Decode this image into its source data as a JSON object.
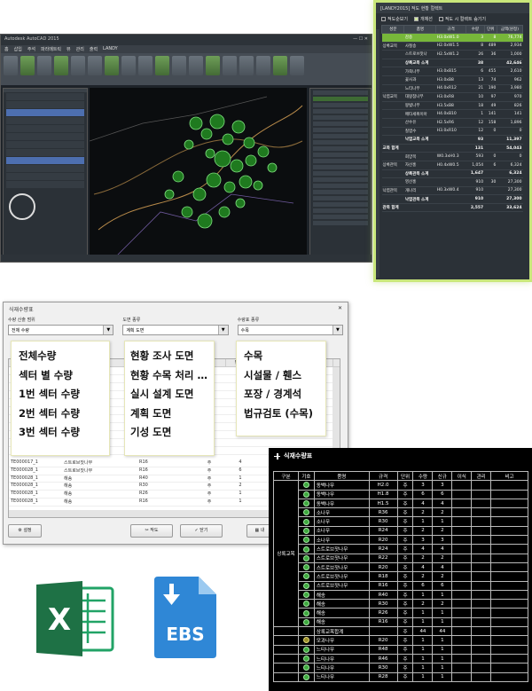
{
  "zoom_panel": {
    "title": "[LANDY2015] 적도 현황 컬렉트",
    "checkboxes": [
      {
        "label": "적도순보기",
        "checked": false
      },
      {
        "label": "개체선",
        "checked": true
      },
      {
        "label": "적도 시 컬렉트 숨기기",
        "checked": false
      }
    ],
    "columns": [
      "성분",
      "품명",
      "규격",
      "수량",
      "단위",
      "금액(원정)"
    ],
    "rows": [
      [
        "",
        "감송",
        "H3.0xW1.0",
        "3",
        "8",
        "76,774"
      ],
      [
        "상록교목",
        "사철송",
        "H2.0xW1.5",
        "8",
        "489",
        "2,934"
      ],
      [
        "",
        "스트로브잣나",
        "H2.5xW1.2",
        "26",
        "36",
        "1,000"
      ],
      [
        "",
        "상록교목 소계",
        "",
        "38",
        "",
        "42,646"
      ],
      [
        "",
        "가죽나무",
        "H3.0xB15",
        "6",
        "455",
        "2,610"
      ],
      [
        "",
        "꽃사과",
        "H3.0xB8",
        "13",
        "74",
        "962"
      ],
      [
        "",
        "느티나무",
        "H4.0xR12",
        "21",
        "190",
        "3,980"
      ],
      [
        "낙엽교목",
        "대왕참나무",
        "H3.0xR8",
        "10",
        "97",
        "970"
      ],
      [
        "",
        "왕벚나무",
        "H3.5xB8",
        "18",
        "49",
        "826"
      ],
      [
        "",
        "메타세쿼이아",
        "H4.0xB10",
        "1",
        "141",
        "141"
      ],
      [
        "",
        "산수유",
        "H2.5xR6",
        "12",
        "158",
        "1,896"
      ],
      [
        "",
        "칠엽수",
        "H3.0xR10",
        "12",
        "0",
        "0"
      ],
      [
        "",
        "낙엽교목 소계",
        "",
        "93",
        "",
        "11,397"
      ],
      [
        "교목 합계",
        "",
        "",
        "131",
        "",
        "54,043"
      ],
      [
        "",
        "회양목",
        "W0.3xH0.3",
        "593",
        "0",
        "0"
      ],
      [
        "상록관목",
        "자산홍",
        "H0.4xW0.5",
        "1,054",
        "6",
        "6,324"
      ],
      [
        "",
        "상록관목 소계",
        "",
        "1,647",
        "",
        "6,324"
      ],
      [
        "",
        "영산홍",
        "",
        "910",
        "30",
        "27,300"
      ],
      [
        "낙엽관목",
        "개나리",
        "H0.3xW0.4",
        "910",
        "",
        "27,300"
      ],
      [
        "",
        "낙엽관목 소계",
        "",
        "910",
        "",
        "27,300"
      ],
      [
        "관목 합계",
        "",
        "",
        "2,557",
        "",
        "33,624"
      ]
    ]
  },
  "dialog": {
    "title": "식재수량표",
    "group1_label": "수량 산출 범위",
    "group1_value": "전체 수량",
    "group2_label": "도면 종류",
    "group2_value": "계획 도면",
    "group3_label": "수량표 종류",
    "group3_value": "수목",
    "grid_header": [
      "",
      "품명",
      "",
      "",
      "단위",
      ""
    ],
    "grid_rows": [
      [
        "TE000017_1",
        "스트로브잣나무",
        "R16",
        "주",
        "4"
      ],
      [
        "TE000028_1",
        "스트로브잣나무",
        "R16",
        "주",
        "6"
      ],
      [
        "TE000028_1",
        "해송",
        "R40",
        "주",
        "1"
      ],
      [
        "TE000028_1",
        "해송",
        "R30",
        "주",
        "2"
      ],
      [
        "TE000028_1",
        "해송",
        "R26",
        "주",
        "1"
      ],
      [
        "TE000028_1",
        "해송",
        "R16",
        "주",
        "1"
      ]
    ],
    "btn_settings": "설정",
    "btn_export": "작도",
    "btn_close": "닫기",
    "btn_extra": "내"
  },
  "options": {
    "range": [
      "전체수량",
      "섹터 별 수량",
      "1번 섹터 수량",
      "2번 섹터 수량",
      "3번 섹터 수량"
    ],
    "drawing": [
      "현황 조사 도면",
      "현황 수목 처리 …",
      "실시 설계 도면",
      "계획 도면",
      "기성 도면"
    ],
    "table": [
      "수목",
      "시설물 / 휀스",
      "포장 / 경계석",
      "법규검토 (수목)"
    ]
  },
  "icons": {
    "excel": {
      "letter": "X",
      "color": "#1e7145"
    },
    "ebs": {
      "label": "EBS",
      "color": "#2f87d6"
    }
  },
  "cad_table": {
    "title": "식재수량표",
    "columns": [
      "구분",
      "기호",
      "품명",
      "규격",
      "단위",
      "수량",
      "신규",
      "이식",
      "관리",
      "비고"
    ],
    "group_label": "상록교목",
    "rows": [
      [
        "",
        "g",
        "동백나무",
        "H2.0",
        "주",
        "3",
        "3",
        "",
        "",
        ""
      ],
      [
        "",
        "g",
        "동백나무",
        "H1.8",
        "주",
        "6",
        "6",
        "",
        "",
        ""
      ],
      [
        "",
        "g",
        "동백나무",
        "H1.5",
        "주",
        "4",
        "4",
        "",
        "",
        ""
      ],
      [
        "",
        "g",
        "소나무",
        "R36",
        "주",
        "2",
        "2",
        "",
        "",
        ""
      ],
      [
        "",
        "g",
        "소나무",
        "R30",
        "주",
        "1",
        "1",
        "",
        "",
        ""
      ],
      [
        "",
        "g",
        "소나무",
        "R24",
        "주",
        "2",
        "2",
        "",
        "",
        ""
      ],
      [
        "",
        "g",
        "소나무",
        "R20",
        "주",
        "3",
        "3",
        "",
        "",
        ""
      ],
      [
        "",
        "g",
        "스트로브잣나무",
        "R24",
        "주",
        "4",
        "4",
        "",
        "",
        ""
      ],
      [
        "",
        "g",
        "스트로브잣나무",
        "R22",
        "주",
        "2",
        "2",
        "",
        "",
        ""
      ],
      [
        "",
        "g",
        "스트로브잣나무",
        "R20",
        "주",
        "4",
        "4",
        "",
        "",
        ""
      ],
      [
        "",
        "g",
        "스트로브잣나무",
        "R18",
        "주",
        "2",
        "2",
        "",
        "",
        ""
      ],
      [
        "",
        "g",
        "스트로브잣나무",
        "R16",
        "주",
        "6",
        "6",
        "",
        "",
        ""
      ],
      [
        "",
        "g",
        "해송",
        "R40",
        "주",
        "1",
        "1",
        "",
        "",
        ""
      ],
      [
        "",
        "g",
        "해송",
        "R30",
        "주",
        "2",
        "2",
        "",
        "",
        ""
      ],
      [
        "",
        "g",
        "해송",
        "R26",
        "주",
        "1",
        "1",
        "",
        "",
        ""
      ],
      [
        "",
        "g",
        "해송",
        "R16",
        "주",
        "1",
        "1",
        "",
        "",
        ""
      ],
      [
        "",
        "",
        "상록교목합계",
        "",
        "주",
        "44",
        "44",
        "",
        "",
        ""
      ],
      [
        "",
        "y",
        "모과나무",
        "R20",
        "주",
        "1",
        "1",
        "",
        "",
        ""
      ],
      [
        "",
        "g",
        "느티나무",
        "R48",
        "주",
        "1",
        "1",
        "",
        "",
        ""
      ],
      [
        "",
        "g",
        "느티나무",
        "R46",
        "주",
        "1",
        "1",
        "",
        "",
        ""
      ],
      [
        "",
        "g",
        "느티나무",
        "R30",
        "주",
        "1",
        "1",
        "",
        "",
        ""
      ],
      [
        "",
        "g",
        "느티나무",
        "R28",
        "주",
        "1",
        "1",
        "",
        "",
        ""
      ]
    ]
  }
}
